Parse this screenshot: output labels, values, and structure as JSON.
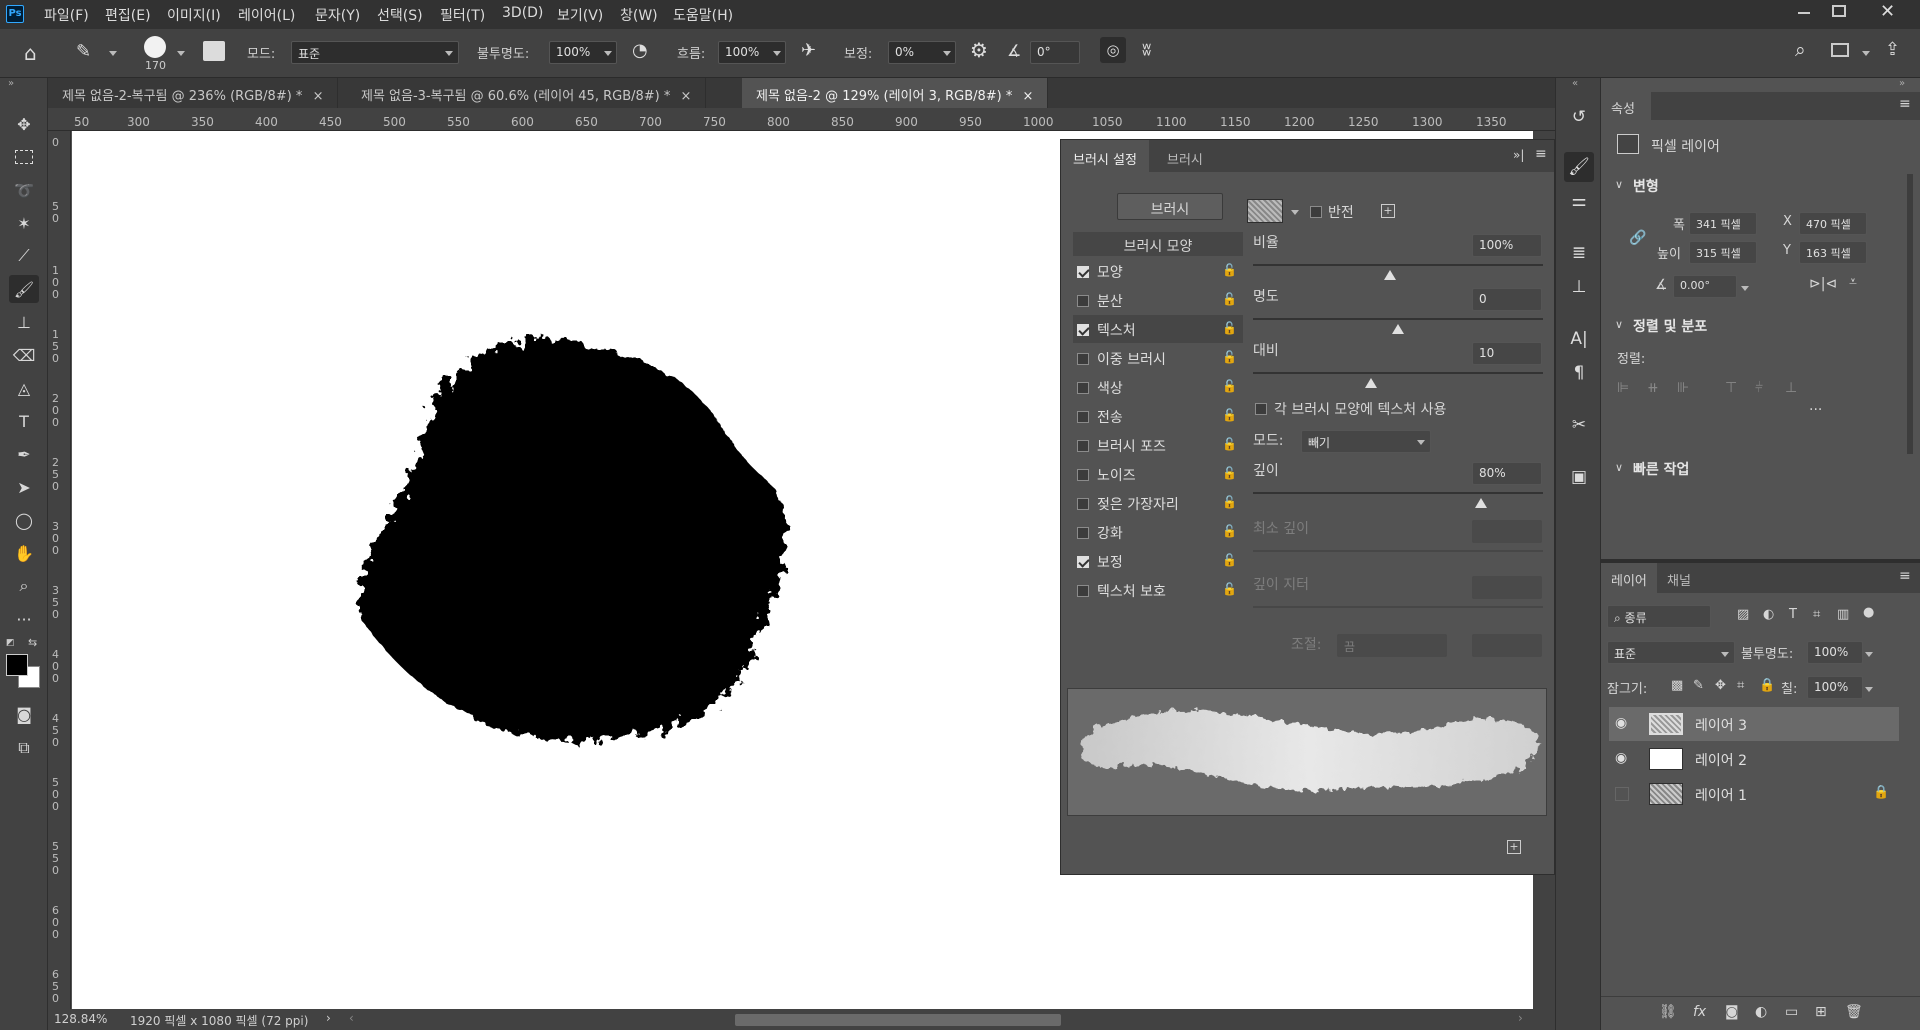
{
  "app": {
    "logo": "Ps"
  },
  "menu": [
    "파일(F)",
    "편집(E)",
    "이미지(I)",
    "레이어(L)",
    "문자(Y)",
    "선택(S)",
    "필터(T)",
    "3D(D)",
    "보기(V)",
    "창(W)",
    "도움말(H)"
  ],
  "options": {
    "brush_size": "170",
    "mode_label": "모드:",
    "mode_value": "표준",
    "opacity_label": "불투명도:",
    "opacity_value": "100%",
    "flow_label": "흐름:",
    "flow_value": "100%",
    "smoothing_label": "보정:",
    "smoothing_value": "0%",
    "angle_value": "0°"
  },
  "tabs": [
    {
      "label": "제목 없음-2-복구됨 @ 236% (RGB/8#) *"
    },
    {
      "label": "제목 없음-3-복구됨 @ 60.6% (레이어 45, RGB/8#) *"
    },
    {
      "label": "제목 없음-2 @ 129% (레이어 3, RGB/8#) *"
    }
  ],
  "ruler_top": [
    "50",
    "300",
    "350",
    "400",
    "450",
    "500",
    "550",
    "600",
    "650",
    "700",
    "750",
    "800",
    "850",
    "900",
    "950",
    "1000",
    "1050",
    "1100",
    "1150",
    "1200",
    "1250",
    "1300",
    "1350"
  ],
  "ruler_left": [
    "0",
    "50",
    "100",
    "150",
    "200",
    "250",
    "300",
    "350",
    "400",
    "450",
    "500",
    "550",
    "600",
    "650"
  ],
  "status": {
    "zoom": "128.84%",
    "doc_info": "1920 픽셀 x 1080 픽셀 (72 ppi)"
  },
  "brush_panel": {
    "tab_settings": "브러시 설정",
    "tab_brushes": "브러시",
    "brush_button": "브러시",
    "invert_label": "반전",
    "tip_shape_header": "브러시 모양",
    "shapes": [
      {
        "label": "모양",
        "checked": true
      },
      {
        "label": "분산",
        "checked": false
      },
      {
        "label": "텍스처",
        "checked": true
      },
      {
        "label": "이중 브러시",
        "checked": false
      },
      {
        "label": "색상",
        "checked": false
      },
      {
        "label": "전송",
        "checked": false
      },
      {
        "label": "브러시 포즈",
        "checked": false
      },
      {
        "label": "노이즈",
        "checked": false
      },
      {
        "label": "젖은 가장자리",
        "checked": false
      },
      {
        "label": "강화",
        "checked": false
      },
      {
        "label": "보정",
        "checked": true
      },
      {
        "label": "텍스처 보호",
        "checked": false
      }
    ],
    "scale_label": "비율",
    "scale_value": "100%",
    "brightness_label": "명도",
    "brightness_value": "0",
    "contrast_label": "대비",
    "contrast_value": "10",
    "each_tip_label": "각 브러시 모양에 텍스처 사용",
    "mode_label": "모드:",
    "mode_value": "빼기",
    "depth_label": "깊이",
    "depth_value": "80%",
    "min_depth_label": "최소 깊이",
    "depth_jitter_label": "깊이 지터",
    "control_label": "조절:",
    "control_value": "끔"
  },
  "properties": {
    "tab": "속성",
    "kind": "픽셀 레이어",
    "transform_header": "변형",
    "w_label": "폭",
    "w_value": "341 픽셀",
    "x_label": "X",
    "x_value": "470 픽셀",
    "h_label": "높이",
    "h_value": "315 픽셀",
    "y_label": "Y",
    "y_value": "163 픽셀",
    "angle_value": "0.00°",
    "align_header": "정렬 및 분포",
    "align_label": "정렬:",
    "quick_header": "빠른 작업"
  },
  "layers_panel": {
    "tab_layers": "레이어",
    "tab_channels": "채널",
    "filter_label": "종류",
    "blend_mode": "표준",
    "opacity_label": "불투명도:",
    "opacity_value": "100%",
    "lock_label": "잠그기:",
    "fill_label": "칠:",
    "fill_value": "100%",
    "layers": [
      {
        "name": "레이어 3",
        "visible": true,
        "selected": true
      },
      {
        "name": "레이어 2",
        "visible": true,
        "selected": false
      },
      {
        "name": "레이어 1",
        "visible": false,
        "selected": false,
        "locked": true
      }
    ]
  },
  "colors": {
    "accent": "#31a8ff",
    "fg": "#000000",
    "bg": "#ffffff"
  }
}
